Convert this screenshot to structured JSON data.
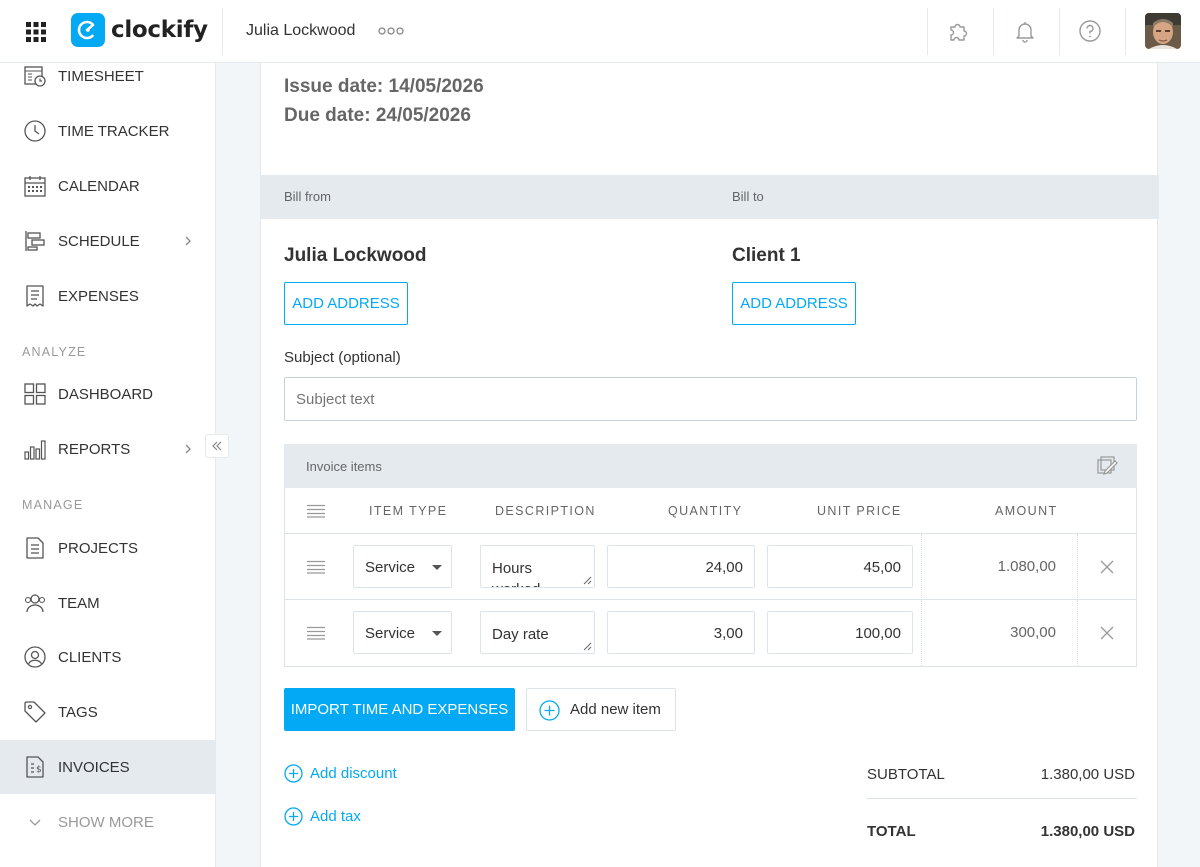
{
  "header": {
    "app_name": "clockify",
    "workspace": "Julia Lockwood",
    "more_dots": "○○○"
  },
  "sidebar": {
    "items_top": [
      {
        "label": "TIMESHEET",
        "icon": "timesheet-icon"
      },
      {
        "label": "TIME TRACKER",
        "icon": "clock-icon"
      },
      {
        "label": "CALENDAR",
        "icon": "calendar-icon"
      },
      {
        "label": "SCHEDULE",
        "icon": "schedule-icon"
      },
      {
        "label": "EXPENSES",
        "icon": "receipt-icon"
      }
    ],
    "section_analyze": "ANALYZE",
    "items_analyze": [
      {
        "label": "DASHBOARD",
        "icon": "dashboard-icon"
      },
      {
        "label": "REPORTS",
        "icon": "reports-icon"
      }
    ],
    "section_manage": "MANAGE",
    "items_manage": [
      {
        "label": "PROJECTS",
        "icon": "document-icon"
      },
      {
        "label": "TEAM",
        "icon": "team-icon"
      },
      {
        "label": "CLIENTS",
        "icon": "person-icon"
      },
      {
        "label": "TAGS",
        "icon": "tag-icon"
      },
      {
        "label": "INVOICES",
        "icon": "invoice-icon"
      }
    ],
    "show_more": "SHOW MORE"
  },
  "invoice": {
    "issue_date": "Issue date: 14/05/2026",
    "due_date": "Due date: 24/05/2026",
    "bill_from_label": "Bill from",
    "bill_to_label": "Bill to",
    "bill_from_name": "Julia Lockwood",
    "bill_to_name": "Client 1",
    "add_address": "ADD ADDRESS",
    "subject_label": "Subject (optional)",
    "subject_placeholder": "Subject text",
    "items_title": "Invoice items",
    "columns": {
      "item_type": "ITEM TYPE",
      "description": "DESCRIPTION",
      "quantity": "QUANTITY",
      "unit_price": "UNIT PRICE",
      "amount": "AMOUNT"
    },
    "rows": [
      {
        "type": "Service",
        "description": "Hours worked",
        "quantity": "24,00",
        "unit_price": "45,00",
        "amount": "1.080,00"
      },
      {
        "type": "Service",
        "description": "Day rate",
        "quantity": "3,00",
        "unit_price": "100,00",
        "amount": "300,00"
      }
    ],
    "import_button": "IMPORT TIME AND EXPENSES",
    "add_item_button": "Add new item",
    "add_discount": "Add discount",
    "add_tax": "Add tax",
    "subtotal_label": "SUBTOTAL",
    "subtotal_value": "1.380,00 USD",
    "total_label": "TOTAL",
    "total_value": "1.380,00 USD"
  },
  "colors": {
    "accent": "#03a9f4",
    "sidebar_active": "#e4eaee",
    "section_header": "#e4eaee"
  }
}
